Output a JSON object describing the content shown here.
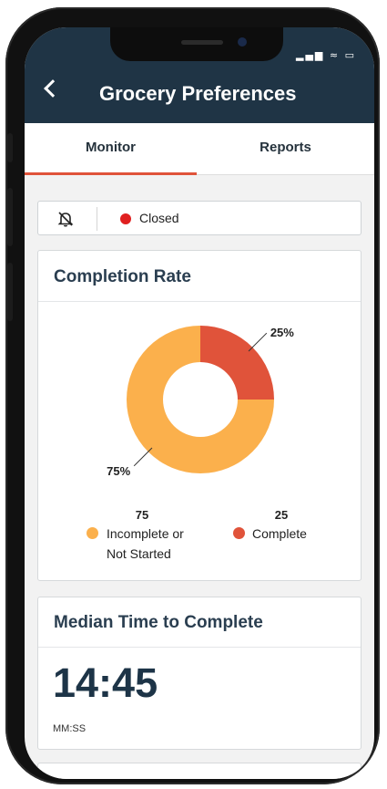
{
  "header": {
    "title": "Grocery Preferences",
    "back_icon": "chevron-left-icon",
    "status_icons": "signal-icon wifi-icon battery-icon",
    "background": "#1f3445"
  },
  "tabs": [
    {
      "label": "Monitor",
      "active": true
    },
    {
      "label": "Reports",
      "active": false
    }
  ],
  "status": {
    "icon": "bell-off-icon",
    "label": "Closed",
    "color": "#e02020"
  },
  "completion_card": {
    "title": "Completion Rate",
    "legend": [
      {
        "value": "75",
        "label": "Incomplete or Not Started",
        "label_line1": "Incomplete or",
        "label_line2": "Not Started",
        "color": "#fbb04c"
      },
      {
        "value": "25",
        "label": "Complete",
        "color": "#e0533a"
      }
    ]
  },
  "chart_data": {
    "type": "pie",
    "donut": true,
    "categories": [
      "Incomplete or Not Started",
      "Complete"
    ],
    "values": [
      75,
      25
    ],
    "data_labels": [
      "75%",
      "25%"
    ],
    "colors": [
      "#fbb04c",
      "#e0533a"
    ],
    "legend_placement": "bottom"
  },
  "median_card": {
    "title": "Median Time to Complete",
    "value": "14:45",
    "units": "MM:SS"
  },
  "accent_color": "#e0533a"
}
